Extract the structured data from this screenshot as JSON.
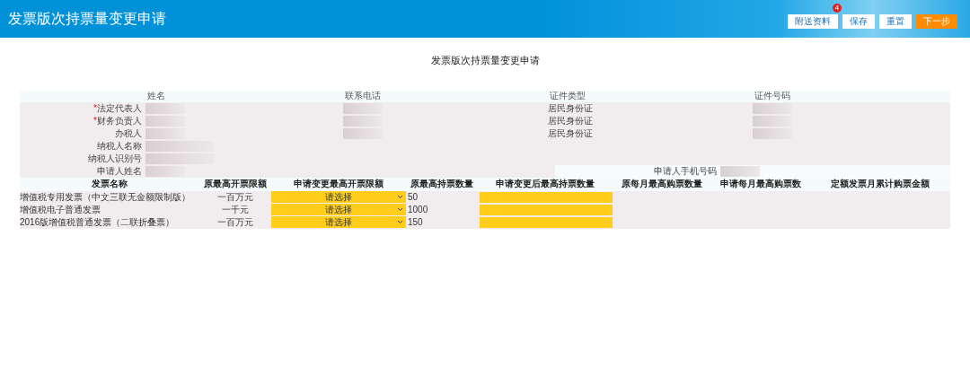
{
  "header": {
    "title": "发票版次持票量变更申请"
  },
  "toolbar": {
    "buttons": [
      {
        "label": "附送资料",
        "kind": "default",
        "badge": "4"
      },
      {
        "label": "保存",
        "kind": "default"
      },
      {
        "label": "重置",
        "kind": "default"
      },
      {
        "label": "下一步",
        "kind": "primary"
      }
    ]
  },
  "form_title": "发票版次持票量变更申请",
  "contacts": {
    "columns": [
      "姓名",
      "联系电话",
      "证件类型",
      "证件号码"
    ],
    "rows": [
      {
        "label": "法定代表人",
        "required_mark": "*",
        "cells": [
          {
            "kind": "blurred"
          },
          {
            "kind": "blurred"
          },
          {
            "kind": "text",
            "text": "居民身份证"
          },
          {
            "kind": "blurred"
          }
        ]
      },
      {
        "label": "财务负责人",
        "required_mark": "*",
        "cells": [
          {
            "kind": "blurred"
          },
          {
            "kind": "blurred"
          },
          {
            "kind": "text",
            "text": "居民身份证"
          },
          {
            "kind": "blurred"
          }
        ]
      },
      {
        "label": "办税人",
        "cells": [
          {
            "kind": "blurred"
          },
          {
            "kind": "blurred"
          },
          {
            "kind": "text",
            "text": "居民身份证"
          },
          {
            "kind": "blurred"
          }
        ]
      },
      {
        "label": "纳税人名称",
        "cells": [
          {
            "kind": "blurred_wide"
          }
        ]
      },
      {
        "label": "纳税人识别号",
        "cells": [
          {
            "kind": "blurred_wide"
          }
        ]
      },
      {
        "label": "申请人姓名",
        "cells": [
          {
            "kind": "blurred"
          }
        ],
        "phone_label": "申请人手机号码"
      }
    ]
  },
  "invoices": {
    "columns": [
      "发票名称",
      "原最高开票限额",
      "申请变更最高开票限额",
      "原最高持票数量",
      "申请变更后最高持票数量",
      "原每月最高购票数量",
      "申请每月最高购票数",
      "定额发票月累计购票金额"
    ],
    "rows": [
      {
        "name": "增值税专用发票（中文三联无金额限制版）",
        "original_limit": "一百万元",
        "requested_limit": "请选择",
        "original_quantity": "50"
      },
      {
        "name": "增值税电子普通发票",
        "original_limit": "一千元",
        "requested_limit": "请选择",
        "original_quantity": "1000"
      },
      {
        "name": "2016版增值税普通发票（二联折叠票）",
        "original_limit": "一百万元",
        "requested_limit": "请选择",
        "original_quantity": "150"
      }
    ]
  }
}
